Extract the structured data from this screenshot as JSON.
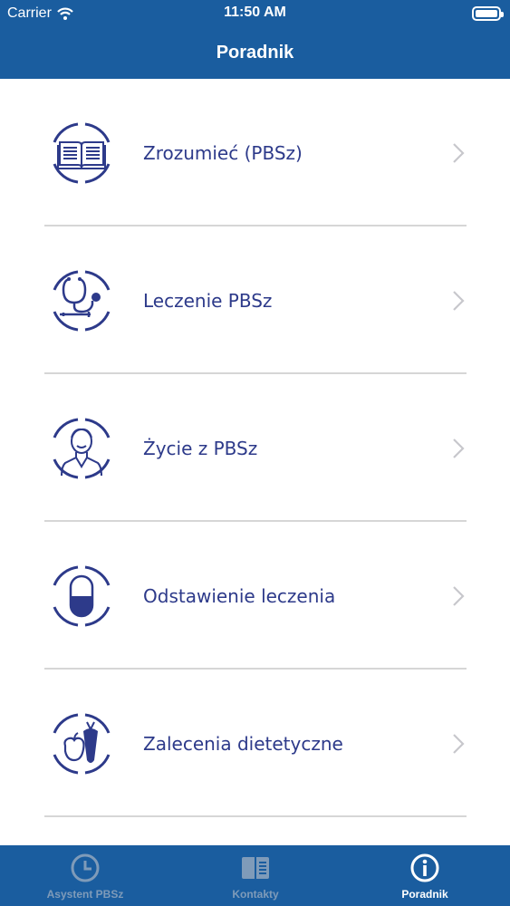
{
  "status_bar": {
    "carrier": "Carrier",
    "time": "11:50 AM"
  },
  "nav": {
    "title": "Poradnik"
  },
  "menu": [
    {
      "label": "Zrozumieć (PBSz)",
      "icon": "book-icon"
    },
    {
      "label": "Leczenie PBSz",
      "icon": "stethoscope-icon"
    },
    {
      "label": "Życie z PBSz",
      "icon": "person-icon"
    },
    {
      "label": "Odstawienie leczenia",
      "icon": "capsule-icon"
    },
    {
      "label": "Zalecenia dietetyczne",
      "icon": "fruit-vegetable-icon"
    }
  ],
  "tabs": [
    {
      "label": "Asystent PBSz",
      "icon": "clock-icon",
      "active": false
    },
    {
      "label": "Kontakty",
      "icon": "contacts-book-icon",
      "active": false
    },
    {
      "label": "Poradnik",
      "icon": "info-icon",
      "active": true
    }
  ],
  "colors": {
    "brand": "#1a5d9f",
    "icon_navy": "#2d3a8a",
    "tab_inactive": "#7f9bb9"
  }
}
